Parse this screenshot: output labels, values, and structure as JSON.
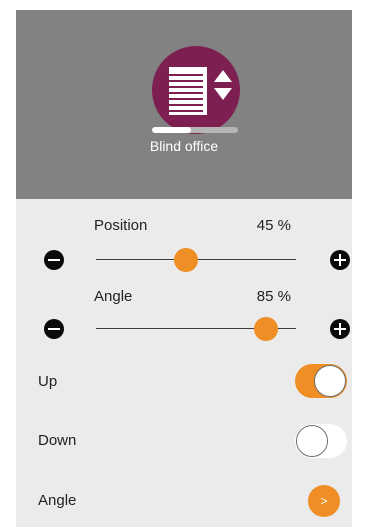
{
  "device": {
    "name": "Blind office",
    "icon": "blind-icon",
    "icon_color": "#7d1f50",
    "level_fraction": 0.45
  },
  "position": {
    "label": "Position",
    "value_text": "45 %",
    "value": 45,
    "decrease_icon": "minus-icon",
    "increase_icon": "plus-icon"
  },
  "angle": {
    "label": "Angle",
    "value_text": "85 %",
    "value": 85
  },
  "toggles": {
    "up": {
      "label": "Up",
      "on": true
    },
    "down": {
      "label": "Down",
      "on": false
    }
  },
  "angle_row": {
    "label": "Angle",
    "button_glyph": ">"
  },
  "colors": {
    "accent": "#ee8e24",
    "header_bg": "#828282",
    "panel_bg": "#ebebeb"
  }
}
